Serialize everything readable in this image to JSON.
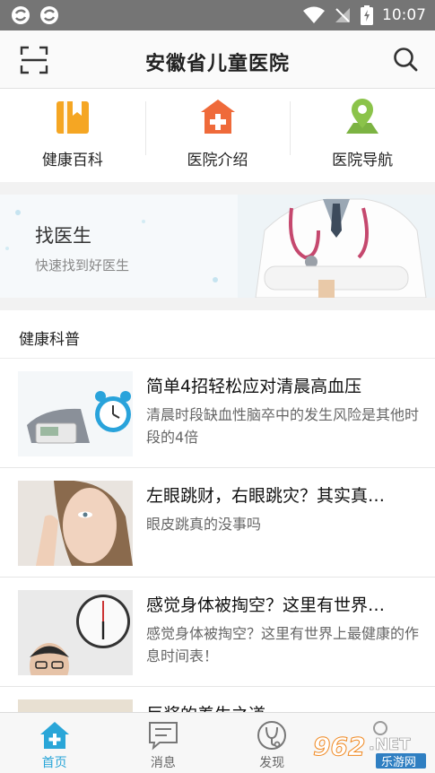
{
  "status_bar": {
    "time": "10:07"
  },
  "header": {
    "title": "安徽省儿童医院"
  },
  "quick_links": [
    {
      "label": "健康百科",
      "icon": "book-icon",
      "color": "#f5a623"
    },
    {
      "label": "医院介绍",
      "icon": "hospital-icon",
      "color": "#ef6a3a"
    },
    {
      "label": "医院导航",
      "icon": "map-pin-icon",
      "color": "#7cb342"
    }
  ],
  "banner": {
    "title": "找医生",
    "subtitle": "快速找到好医生"
  },
  "section": {
    "title": "健康科普"
  },
  "articles": [
    {
      "title": "简单4招轻松应对清晨高血压",
      "desc": "清晨时段缺血性脑卒中的发生风险是其他时段的4倍"
    },
    {
      "title": "左眼跳财，右眼跳灾？其实真…",
      "desc": "眼皮跳真的没事吗"
    },
    {
      "title": "感觉身体被掏空？这里有世界…",
      "desc": "感觉身体被掏空？这里有世界上最健康的作息时间表！"
    },
    {
      "title": "巨浆的养生之道",
      "desc": ""
    }
  ],
  "tabs": [
    {
      "label": "首页",
      "icon": "home-icon",
      "active": true
    },
    {
      "label": "消息",
      "icon": "message-icon",
      "active": false
    },
    {
      "label": "发现",
      "icon": "stethoscope-icon",
      "active": false
    }
  ],
  "watermark": {
    "text": "962.NET",
    "sub": "乐游网"
  },
  "colors": {
    "accent": "#2aa6d8",
    "statusbar": "#757575"
  }
}
